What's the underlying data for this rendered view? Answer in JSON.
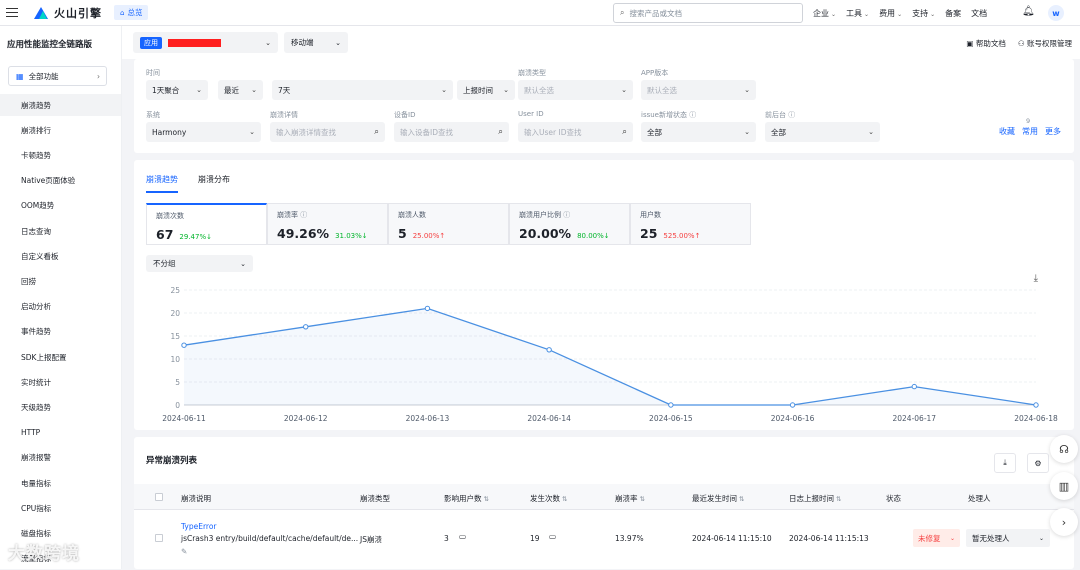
{
  "header": {
    "brand": "火山引擎",
    "home_tab": "总览",
    "search_placeholder": "搜索产品或文档",
    "nav": [
      "企业",
      "工具",
      "费用",
      "支持",
      "备案",
      "文档"
    ],
    "avatar": "w"
  },
  "sidebar": {
    "title": "应用性能监控全链路版",
    "all_functions": "全部功能",
    "items": [
      "崩溃趋势",
      "崩溃排行",
      "卡顿趋势",
      "Native页面体验",
      "OOM趋势",
      "日志查询",
      "自定义看板",
      "回捞",
      "启动分析",
      "事件趋势",
      "SDK上报配置",
      "实时统计",
      "天级趋势",
      "HTTP",
      "崩溃报警",
      "电量指标",
      "CPU指标",
      "磁盘指标",
      "流量指标"
    ]
  },
  "subheader": {
    "app_badge": "应用",
    "platform": "移动端",
    "help_docs": "帮助文档",
    "account_perms": "账号权限管理"
  },
  "filters": {
    "time_label": "时间",
    "aggregation": "1天聚合",
    "recent": "最近",
    "range": "7天",
    "report_time": "上报时间",
    "crash_type_label": "崩溃类型",
    "crash_type_value": "默认全选",
    "app_version_label": "APP版本",
    "app_version_value": "默认全选",
    "system_label": "系统",
    "system_value": "Harmony",
    "crash_detail_label": "崩溃详情",
    "crash_detail_placeholder": "输入崩溃详情查找",
    "device_id_label": "设备ID",
    "device_id_placeholder": "输入设备ID查找",
    "user_id_label": "User ID",
    "user_id_placeholder": "输入User ID查找",
    "issue_status_label": "issue新增状态",
    "issue_status_value": "全部",
    "foreground_label": "前后台",
    "foreground_value": "全部",
    "collect": "收藏",
    "common": "常用",
    "common_count": "9",
    "more": "更多"
  },
  "trend": {
    "tabs": [
      "崩溃趋势",
      "崩溃分布"
    ],
    "metrics": [
      {
        "title": "崩溃次数",
        "value": "67",
        "change": "29.47%",
        "dir": "↓"
      },
      {
        "title": "崩溃率",
        "value": "49.26%",
        "change": "31.03%",
        "dir": "↓"
      },
      {
        "title": "崩溃人数",
        "value": "5",
        "change": "25.00%",
        "dir": "↑"
      },
      {
        "title": "崩溃用户比例",
        "value": "20.00%",
        "change": "80.00%",
        "dir": "↓"
      },
      {
        "title": "用户数",
        "value": "25",
        "change": "525.00%",
        "dir": "↑"
      }
    ],
    "group_by": "不分组"
  },
  "chart_data": {
    "type": "line",
    "x": [
      "2024-06-11",
      "2024-06-12",
      "2024-06-13",
      "2024-06-14",
      "2024-06-15",
      "2024-06-16",
      "2024-06-17",
      "2024-06-18"
    ],
    "series": [
      {
        "values": [
          13,
          17,
          21,
          12,
          0,
          0,
          4,
          0
        ]
      }
    ],
    "yticks": [
      0,
      5,
      10,
      15,
      20,
      25
    ],
    "ylim": [
      0,
      25
    ],
    "color": "#4a90e2",
    "grid": true
  },
  "crash_list": {
    "title": "异常崩溃列表",
    "columns": [
      "崩溃说明",
      "崩溃类型",
      "影响用户数",
      "发生次数",
      "崩溃率",
      "最近发生时间",
      "日志上报时间",
      "状态",
      "处理人"
    ],
    "rows": [
      {
        "error_type": "TypeError",
        "desc": "jsCrash3 entry/build/default/cache/default/de...",
        "crash_type": "JS崩溃",
        "users": "3",
        "count": "19",
        "rate": "13.97%",
        "last_time": "2024-06-14 11:15:10",
        "log_time": "2024-06-14 11:15:13",
        "status": "未修复",
        "handler": "暂无处理人"
      }
    ]
  },
  "watermark": "大数跨境"
}
